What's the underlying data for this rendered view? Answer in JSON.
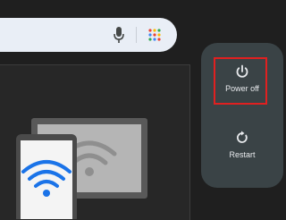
{
  "search": {
    "mic_icon": "mic-icon",
    "apps_icon": "apps-grid-icon"
  },
  "power_menu": {
    "options": [
      {
        "label": "Power off",
        "icon": "power-icon"
      },
      {
        "label": "Restart",
        "icon": "restart-icon"
      }
    ],
    "highlighted": "Power off",
    "highlight_color": "#e02020"
  },
  "colors": {
    "background": "#1f1f1f",
    "menu_background": "#3a4346",
    "search_background": "#e9eef6",
    "wifi_blue": "#1a73e8"
  }
}
